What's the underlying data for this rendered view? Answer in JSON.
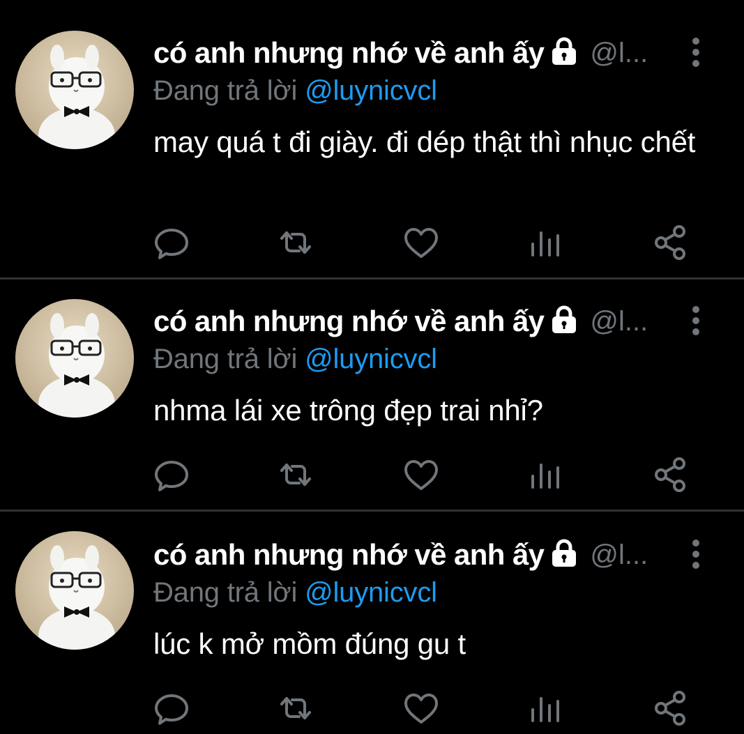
{
  "colors": {
    "background": "#000000",
    "text_primary": "#ffffff",
    "text_secondary": "#71767b",
    "mention": "#1d9bf0",
    "divider": "#2f3336"
  },
  "tweets": [
    {
      "display_name": "có anh nhưng nhớ về anh ấy",
      "handle": "@l...",
      "reply_prefix": "Đang trả lời",
      "reply_mention": "@luynicvcl",
      "text": "may quá t đi giày. đi dép thật thì nhục chết"
    },
    {
      "display_name": "có anh nhưng nhớ về anh ấy",
      "handle": "@l...",
      "reply_prefix": "Đang trả lời",
      "reply_mention": "@luynicvcl",
      "text": "nhma lái xe trông đẹp trai nhỉ?"
    },
    {
      "display_name": "có anh nhưng nhớ về anh ấy",
      "handle": "@l...",
      "reply_prefix": "Đang trả lời",
      "reply_mention": "@luynicvcl",
      "text": "lúc k mở mồm đúng gu t"
    }
  ],
  "icons": {
    "lock": "lock-icon",
    "more": "more-vertical-icon",
    "reply": "reply-bubble-icon",
    "retweet": "retweet-icon",
    "like": "heart-icon",
    "analytics": "analytics-bars-icon",
    "share": "share-nodes-icon"
  }
}
